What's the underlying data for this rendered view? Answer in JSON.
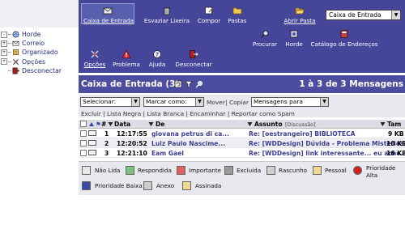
{
  "sidebar": {
    "items": [
      {
        "label": "Horde",
        "icon": "horde-globe-icon",
        "expander": "-"
      },
      {
        "label": "Correio",
        "icon": "mail-icon",
        "expander": "+"
      },
      {
        "label": "Organizado",
        "icon": "organizer-icon",
        "expander": "+"
      },
      {
        "label": "Opções",
        "icon": "options-icon",
        "expander": "+"
      },
      {
        "label": "Desconectar",
        "icon": "logout-icon",
        "expander": ""
      }
    ]
  },
  "toolbar": {
    "row1": [
      {
        "label": "Caixa de Entrada",
        "icon": "inbox-icon",
        "active": true
      },
      {
        "label": "Esvaziar Lixeira",
        "icon": "trash-icon"
      },
      {
        "label": "Compor",
        "icon": "compose-icon"
      },
      {
        "label": "Pastas",
        "icon": "folders-icon"
      },
      {
        "label": "Abrir Pasta",
        "icon": "open-folder-icon"
      }
    ],
    "row2": [
      {
        "label": "Procurar",
        "icon": "search-icon"
      },
      {
        "label": "Horde",
        "icon": "horde-icon"
      },
      {
        "label": "Catálogo de Endereços",
        "icon": "address-book-icon"
      }
    ],
    "row3": [
      {
        "label": "Opções",
        "icon": "options-icon"
      },
      {
        "label": "Problema",
        "icon": "problem-icon"
      },
      {
        "label": "Ajuda",
        "icon": "help-icon"
      },
      {
        "label": "Desconectar",
        "icon": "logout-icon"
      }
    ],
    "mailbox_select": "Caixa de Entrada"
  },
  "mailbox": {
    "title": "Caixa de Entrada (3)",
    "count_text": "1 à 3 de 3 Mensagens"
  },
  "actions": {
    "select_label": "Selecionar:",
    "mark_label": "Marcar como:",
    "move": "Mover",
    "separator": "|",
    "copy": "Copiar",
    "messages_to": "Mensagens para",
    "delete": "Excluir",
    "blacklist": "Lista Negra",
    "whitelist": "Lista Branca",
    "forward": "Encaminhar",
    "report_spam": "Reportar como Spam"
  },
  "table": {
    "headers": {
      "num": "#",
      "date": "Data",
      "from": "De",
      "subject": "Assunto",
      "subject_extra": "[Discussão]",
      "size": "Tam"
    },
    "rows": [
      {
        "num": "1",
        "date": "12:17:55",
        "from": "giovana petrus di ca...",
        "subject": "Re: [oestrangeiro] BIBLIOTECA",
        "size": "9 KB"
      },
      {
        "num": "2",
        "date": "12:20:52",
        "from": "Luiz Paulo Nascime...",
        "subject": "Re: [WDDesign] Dúvida - Problema Misterioso",
        "size": "10 KB"
      },
      {
        "num": "3",
        "date": "12:21:10",
        "from": "Eam Gael",
        "subject": "Re: [WDDesign] link interessante... eu acho..:-)",
        "size": "16 KB"
      }
    ]
  },
  "legend": [
    {
      "label": "Não Lida",
      "icon": "unread-icon",
      "color": "#e8e8e8"
    },
    {
      "label": "Respondida",
      "icon": "answered-icon",
      "color": "#7fbf7f"
    },
    {
      "label": "Importante",
      "icon": "important-icon",
      "color": "#e06060"
    },
    {
      "label": "Excluída",
      "icon": "deleted-icon",
      "color": "#9a9a9a"
    },
    {
      "label": "Rascunho",
      "icon": "draft-icon",
      "color": "#d0d0d0"
    },
    {
      "label": "Pessoal",
      "icon": "personal-icon",
      "color": "#f0d890"
    },
    {
      "label": "Prioridade Alta",
      "icon": "high-priority-icon",
      "color": "#d02020"
    },
    {
      "label": "Prioridade Baixa",
      "icon": "low-priority-icon",
      "color": "#3a4aa0"
    },
    {
      "label": "Anexo",
      "icon": "attachment-icon",
      "color": "#cccccc"
    },
    {
      "label": "Assinada",
      "icon": "signed-icon",
      "color": "#f0d890"
    }
  ]
}
